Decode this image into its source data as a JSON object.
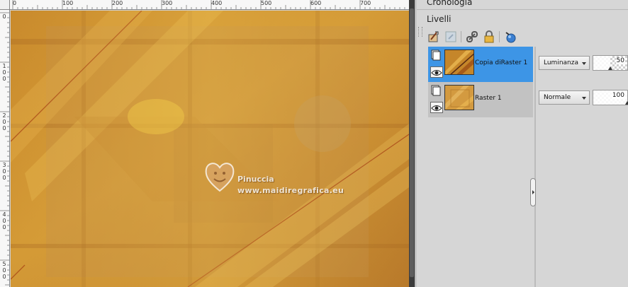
{
  "rulers": {
    "top_labels": [
      "0",
      "100",
      "200",
      "300",
      "400",
      "500",
      "600",
      "700"
    ],
    "left_labels": [
      "0",
      "100",
      "200",
      "300",
      "400",
      "500"
    ]
  },
  "canvas": {
    "watermark_line1": "Pinuccia",
    "watermark_line2": "www.maidiregrafica.eu"
  },
  "panel": {
    "history_title": "Cronologia",
    "layers_title": "Livelli",
    "toolbar_icons": [
      "new-layer-icon",
      "mask-icon",
      "link-icon",
      "lock-icon",
      "fx-icon"
    ],
    "layers": [
      {
        "name": "Copia diRaster 1",
        "selected": true,
        "blend_mode": "Luminanza",
        "opacity": "50"
      },
      {
        "name": "Raster 1",
        "selected": false,
        "blend_mode": "Normale",
        "opacity": "100"
      }
    ]
  },
  "colors": {
    "selection": "#3d95e6",
    "canvas_base": "#c98f2e",
    "canvas_accent": "#e0b13f"
  }
}
